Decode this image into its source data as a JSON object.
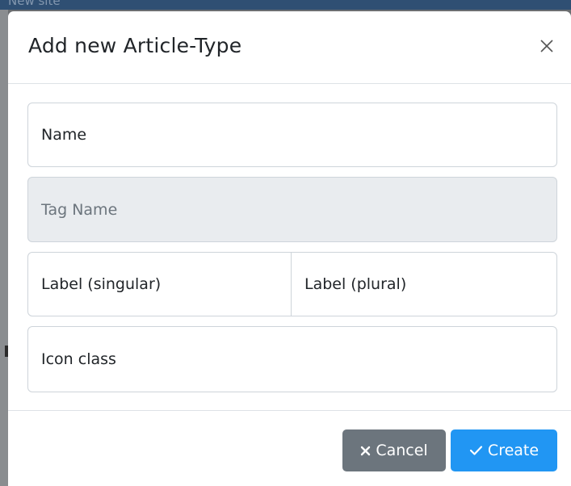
{
  "background": {
    "peek_text": "New site",
    "header_color": "#2f4f73"
  },
  "modal": {
    "title": "Add new Article-Type",
    "close_icon": "close-icon"
  },
  "form": {
    "name_placeholder": "Name",
    "tag_name_placeholder": "Tag Name",
    "label_singular_placeholder": "Label (singular)",
    "label_plural_placeholder": "Label (plural)",
    "icon_class_placeholder": "Icon class"
  },
  "footer": {
    "cancel_label": "Cancel",
    "cancel_icon": "x-icon",
    "create_label": "Create",
    "create_icon": "check-icon"
  },
  "colors": {
    "cancel_bg": "#6c757d",
    "create_bg": "#2196f3",
    "disabled_field_bg": "#e9ecef"
  }
}
